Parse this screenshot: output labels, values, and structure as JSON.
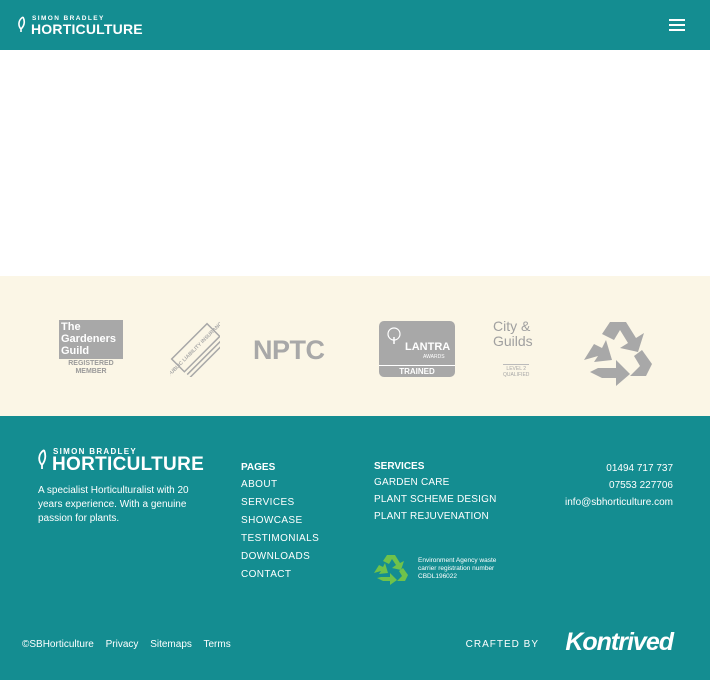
{
  "header": {
    "brand_small": "SIMON BRADLEY",
    "brand_big": "HORTICULTURE",
    "menu_icon": "hamburger-menu-icon",
    "background": "#148d91"
  },
  "badges": {
    "background": "#fbf6e6",
    "gardeners_guild": {
      "line1": "The",
      "line2": "Gardeners",
      "line3": "Guild",
      "sub1": "REGISTERED",
      "sub2": "MEMBER"
    },
    "public_liability": "PUBLIC LIABILITY INSURANCE",
    "npt": "NPTC",
    "lantra": {
      "name": "LANTRA",
      "awards": "AWARDS",
      "trained": "TRAINED"
    },
    "city_guilds": {
      "line1": "City &",
      "line2": "Guilds",
      "level1": "LEVEL 2",
      "level2": "QUALIFIED"
    },
    "recycle_icon": "recycle-icon"
  },
  "footer": {
    "brand_small": "SIMON BRADLEY",
    "brand_big": "HORTICULTURE",
    "about": "A specialist Horticulturalist with 20 years experience. With a genuine passion for plants.",
    "pages_heading": "PAGES",
    "pages": [
      "ABOUT",
      "SERVICES",
      "SHOWCASE",
      "TESTIMONIALS",
      "DOWNLOADS",
      "CONTACT"
    ],
    "services_heading": "SERVICES",
    "services": [
      "GARDEN CARE",
      "PLANT SCHEME DESIGN",
      "PLANT REJUVENATION"
    ],
    "phone1": "01494 717 737",
    "phone2": "07553 227706",
    "email": "info@sbhorticulture.com",
    "env_line1": "Environment Agency waste",
    "env_line2": "carrier registration number",
    "env_line3": "CBDL196022",
    "copyright": "©SBHorticulture",
    "privacy": "Privacy",
    "sitemaps": "Sitemaps",
    "terms": "Terms",
    "crafted_by": "CRAFTED BY",
    "agency": "Kontrived"
  }
}
